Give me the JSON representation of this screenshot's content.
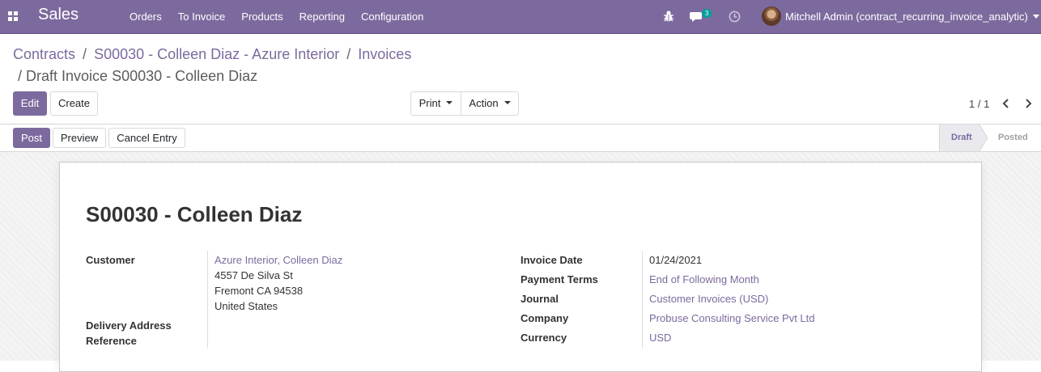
{
  "navbar": {
    "app_name": "Sales",
    "menu": [
      "Orders",
      "To Invoice",
      "Products",
      "Reporting",
      "Configuration"
    ],
    "chat_count": "3",
    "user_name": "Mitchell Admin (contract_recurring_invoice_analytic)",
    "icons": [
      "apps-icon",
      "bug-icon",
      "chat-icon",
      "clock-icon",
      "avatar"
    ],
    "color": "#7c6a9e"
  },
  "breadcrumb": {
    "items": [
      "Contracts",
      "S00030 - Colleen Diaz - Azure Interior",
      "Invoices"
    ],
    "separator": "/",
    "current": "Draft Invoice S00030 - Colleen Diaz"
  },
  "actions": {
    "edit": "Edit",
    "create": "Create",
    "print": "Print",
    "action": "Action"
  },
  "pager": {
    "value": "1 / 1"
  },
  "status_buttons": {
    "post": "Post",
    "preview": "Preview",
    "cancel": "Cancel Entry"
  },
  "stages": {
    "draft": "Draft",
    "posted": "Posted",
    "current": "Draft"
  },
  "invoice": {
    "title": "S00030 - Colleen Diaz",
    "customer_label": "Customer",
    "customer_name": "Azure Interior, Colleen Diaz",
    "address_line1": "4557 De Silva St",
    "address_line2": "Fremont CA 94538",
    "address_line3": "United States",
    "delivery_label": "Delivery Address",
    "reference_label": "Reference",
    "invoice_date_label": "Invoice Date",
    "invoice_date": "01/24/2021",
    "payment_terms_label": "Payment Terms",
    "payment_terms": "End of Following Month",
    "journal_label": "Journal",
    "journal": "Customer Invoices (USD)",
    "company_label": "Company",
    "company": "Probuse Consulting Service Pvt Ltd",
    "currency_label": "Currency",
    "currency": "USD"
  }
}
